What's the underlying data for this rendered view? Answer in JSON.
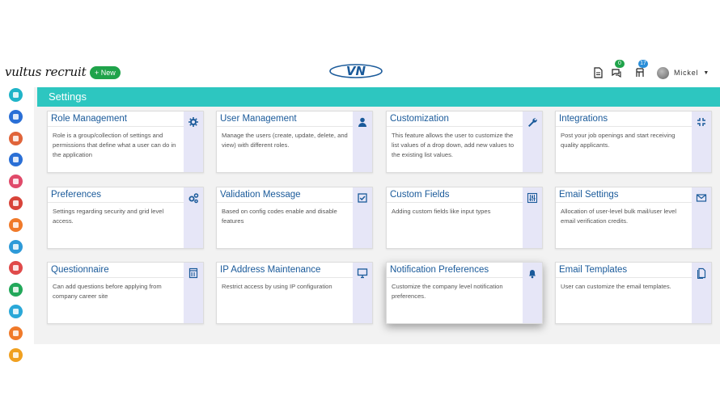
{
  "header": {
    "logo_text": "vultus recruit",
    "new_button_label": "New",
    "chat_badge": "0",
    "inbox_badge": "17",
    "user_name": "Mickel",
    "center_logo_text": "VN"
  },
  "colors": {
    "accent": "#2dc6c0",
    "title": "#1a5a9a",
    "card_side": "#e6e6f7",
    "new_button": "#1fa34a"
  },
  "page": {
    "title": "Settings"
  },
  "sidebar": {
    "items": [
      {
        "icon": "dashboard-icon",
        "color": "#20b4c8"
      },
      {
        "icon": "people-icon",
        "color": "#2a6fd6"
      },
      {
        "icon": "briefcase-icon",
        "color": "#e0643a"
      },
      {
        "icon": "profile-card-icon",
        "color": "#2a6fd6"
      },
      {
        "icon": "funnel-icon",
        "color": "#e04a6a"
      },
      {
        "icon": "pie-chart-icon",
        "color": "#d8443a"
      },
      {
        "icon": "fire-icon",
        "color": "#f07a2a"
      },
      {
        "icon": "document-icon",
        "color": "#2e9ad8"
      },
      {
        "icon": "id-card-icon",
        "color": "#e04a4a"
      },
      {
        "icon": "mail-icon",
        "color": "#22a85a"
      },
      {
        "icon": "mail-open-icon",
        "color": "#2aa8d8"
      },
      {
        "icon": "chat-icon",
        "color": "#f07a2a"
      },
      {
        "icon": "reports-icon",
        "color": "#f0a020"
      }
    ]
  },
  "cards": [
    {
      "title": "Role Management",
      "desc": "Role is a group/collection of settings and permissions that define what a user can do in the application",
      "icon": "gear-icon"
    },
    {
      "title": "User Management",
      "desc": "Manage the users (create, update, delete, and view) with different roles.",
      "icon": "user-icon"
    },
    {
      "title": "Customization",
      "desc": "This feature allows the user to customize the list values of a drop down, add new values to the existing list values.",
      "icon": "wrench-icon"
    },
    {
      "title": "Integrations",
      "desc": "Post your job openings and start receiving quality applicants.",
      "icon": "compress-icon"
    },
    {
      "title": "Preferences",
      "desc": "Settings regarding security and grid level access.",
      "icon": "gears-icon"
    },
    {
      "title": "Validation Message",
      "desc": "Based on config codes enable and disable features",
      "icon": "checkbox-icon"
    },
    {
      "title": "Custom Fields",
      "desc": "Adding custom fields like input types",
      "icon": "sliders-icon"
    },
    {
      "title": "Email Settings",
      "desc": "Allocation of user-level bulk mail/user level email verification credits.",
      "icon": "envelope-icon"
    },
    {
      "title": "Questionnaire",
      "desc": "Can add questions before applying from company career site",
      "icon": "form-icon"
    },
    {
      "title": "IP Address Maintenance",
      "desc": "Restrict access by using IP configuration",
      "icon": "monitor-icon"
    },
    {
      "title": "Notification Preferences",
      "desc": "Customize the company level notification preferences.",
      "icon": "bell-icon"
    },
    {
      "title": "Email Templates",
      "desc": "User can customize the email templates.",
      "icon": "template-icon"
    }
  ]
}
